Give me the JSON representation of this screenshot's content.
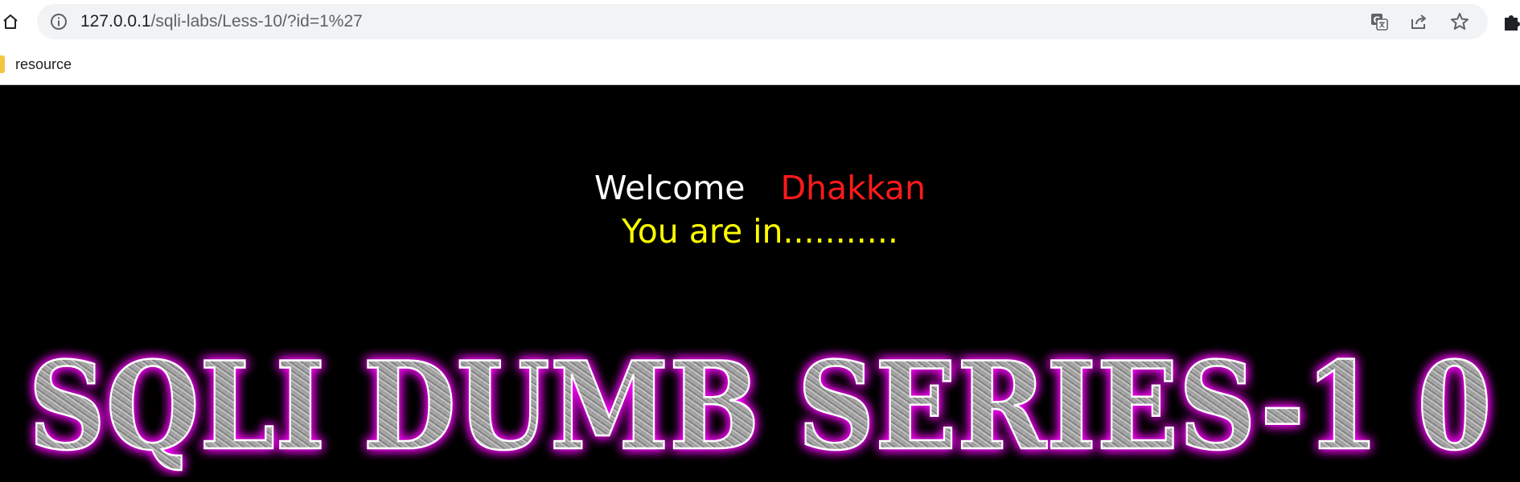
{
  "browser": {
    "url_host": "127.0.0.1",
    "url_path": "/sqli-labs/Less-10/?id=1%27",
    "icons": {
      "home": "home-icon",
      "info": "info-icon",
      "translate": "translate-icon",
      "share": "share-icon",
      "bookmark": "star-icon",
      "extensions": "puzzle-icon"
    }
  },
  "bookmarks": {
    "items": [
      {
        "label": "resource",
        "icon": "folder-icon"
      }
    ]
  },
  "page": {
    "welcome": "Welcome",
    "username": "Dhakkan",
    "status": "You are in...........",
    "banner_text": "SQLI DUMB SERIES-1 0",
    "colors": {
      "background": "#000000",
      "welcome": "#ffffff",
      "username": "#ff1a1a",
      "status": "#ffff00",
      "banner_glow": "#ff00ff",
      "banner_metal": "#9a9a9a"
    }
  }
}
